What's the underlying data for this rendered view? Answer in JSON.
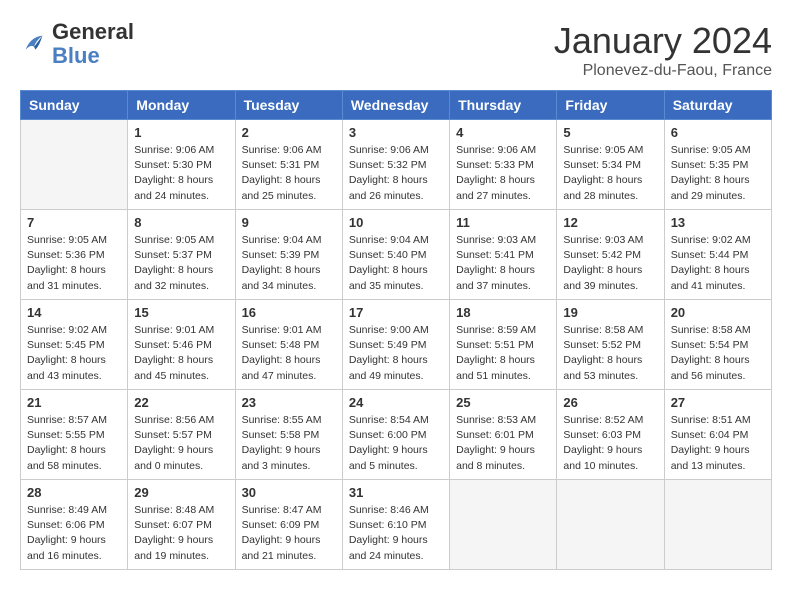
{
  "header": {
    "logo_general": "General",
    "logo_blue": "Blue",
    "month_title": "January 2024",
    "subtitle": "Plonevez-du-Faou, France"
  },
  "days_of_week": [
    "Sunday",
    "Monday",
    "Tuesday",
    "Wednesday",
    "Thursday",
    "Friday",
    "Saturday"
  ],
  "weeks": [
    [
      {
        "num": "",
        "sunrise": "",
        "sunset": "",
        "daylight": ""
      },
      {
        "num": "1",
        "sunrise": "Sunrise: 9:06 AM",
        "sunset": "Sunset: 5:30 PM",
        "daylight": "Daylight: 8 hours and 24 minutes."
      },
      {
        "num": "2",
        "sunrise": "Sunrise: 9:06 AM",
        "sunset": "Sunset: 5:31 PM",
        "daylight": "Daylight: 8 hours and 25 minutes."
      },
      {
        "num": "3",
        "sunrise": "Sunrise: 9:06 AM",
        "sunset": "Sunset: 5:32 PM",
        "daylight": "Daylight: 8 hours and 26 minutes."
      },
      {
        "num": "4",
        "sunrise": "Sunrise: 9:06 AM",
        "sunset": "Sunset: 5:33 PM",
        "daylight": "Daylight: 8 hours and 27 minutes."
      },
      {
        "num": "5",
        "sunrise": "Sunrise: 9:05 AM",
        "sunset": "Sunset: 5:34 PM",
        "daylight": "Daylight: 8 hours and 28 minutes."
      },
      {
        "num": "6",
        "sunrise": "Sunrise: 9:05 AM",
        "sunset": "Sunset: 5:35 PM",
        "daylight": "Daylight: 8 hours and 29 minutes."
      }
    ],
    [
      {
        "num": "7",
        "sunrise": "Sunrise: 9:05 AM",
        "sunset": "Sunset: 5:36 PM",
        "daylight": "Daylight: 8 hours and 31 minutes."
      },
      {
        "num": "8",
        "sunrise": "Sunrise: 9:05 AM",
        "sunset": "Sunset: 5:37 PM",
        "daylight": "Daylight: 8 hours and 32 minutes."
      },
      {
        "num": "9",
        "sunrise": "Sunrise: 9:04 AM",
        "sunset": "Sunset: 5:39 PM",
        "daylight": "Daylight: 8 hours and 34 minutes."
      },
      {
        "num": "10",
        "sunrise": "Sunrise: 9:04 AM",
        "sunset": "Sunset: 5:40 PM",
        "daylight": "Daylight: 8 hours and 35 minutes."
      },
      {
        "num": "11",
        "sunrise": "Sunrise: 9:03 AM",
        "sunset": "Sunset: 5:41 PM",
        "daylight": "Daylight: 8 hours and 37 minutes."
      },
      {
        "num": "12",
        "sunrise": "Sunrise: 9:03 AM",
        "sunset": "Sunset: 5:42 PM",
        "daylight": "Daylight: 8 hours and 39 minutes."
      },
      {
        "num": "13",
        "sunrise": "Sunrise: 9:02 AM",
        "sunset": "Sunset: 5:44 PM",
        "daylight": "Daylight: 8 hours and 41 minutes."
      }
    ],
    [
      {
        "num": "14",
        "sunrise": "Sunrise: 9:02 AM",
        "sunset": "Sunset: 5:45 PM",
        "daylight": "Daylight: 8 hours and 43 minutes."
      },
      {
        "num": "15",
        "sunrise": "Sunrise: 9:01 AM",
        "sunset": "Sunset: 5:46 PM",
        "daylight": "Daylight: 8 hours and 45 minutes."
      },
      {
        "num": "16",
        "sunrise": "Sunrise: 9:01 AM",
        "sunset": "Sunset: 5:48 PM",
        "daylight": "Daylight: 8 hours and 47 minutes."
      },
      {
        "num": "17",
        "sunrise": "Sunrise: 9:00 AM",
        "sunset": "Sunset: 5:49 PM",
        "daylight": "Daylight: 8 hours and 49 minutes."
      },
      {
        "num": "18",
        "sunrise": "Sunrise: 8:59 AM",
        "sunset": "Sunset: 5:51 PM",
        "daylight": "Daylight: 8 hours and 51 minutes."
      },
      {
        "num": "19",
        "sunrise": "Sunrise: 8:58 AM",
        "sunset": "Sunset: 5:52 PM",
        "daylight": "Daylight: 8 hours and 53 minutes."
      },
      {
        "num": "20",
        "sunrise": "Sunrise: 8:58 AM",
        "sunset": "Sunset: 5:54 PM",
        "daylight": "Daylight: 8 hours and 56 minutes."
      }
    ],
    [
      {
        "num": "21",
        "sunrise": "Sunrise: 8:57 AM",
        "sunset": "Sunset: 5:55 PM",
        "daylight": "Daylight: 8 hours and 58 minutes."
      },
      {
        "num": "22",
        "sunrise": "Sunrise: 8:56 AM",
        "sunset": "Sunset: 5:57 PM",
        "daylight": "Daylight: 9 hours and 0 minutes."
      },
      {
        "num": "23",
        "sunrise": "Sunrise: 8:55 AM",
        "sunset": "Sunset: 5:58 PM",
        "daylight": "Daylight: 9 hours and 3 minutes."
      },
      {
        "num": "24",
        "sunrise": "Sunrise: 8:54 AM",
        "sunset": "Sunset: 6:00 PM",
        "daylight": "Daylight: 9 hours and 5 minutes."
      },
      {
        "num": "25",
        "sunrise": "Sunrise: 8:53 AM",
        "sunset": "Sunset: 6:01 PM",
        "daylight": "Daylight: 9 hours and 8 minutes."
      },
      {
        "num": "26",
        "sunrise": "Sunrise: 8:52 AM",
        "sunset": "Sunset: 6:03 PM",
        "daylight": "Daylight: 9 hours and 10 minutes."
      },
      {
        "num": "27",
        "sunrise": "Sunrise: 8:51 AM",
        "sunset": "Sunset: 6:04 PM",
        "daylight": "Daylight: 9 hours and 13 minutes."
      }
    ],
    [
      {
        "num": "28",
        "sunrise": "Sunrise: 8:49 AM",
        "sunset": "Sunset: 6:06 PM",
        "daylight": "Daylight: 9 hours and 16 minutes."
      },
      {
        "num": "29",
        "sunrise": "Sunrise: 8:48 AM",
        "sunset": "Sunset: 6:07 PM",
        "daylight": "Daylight: 9 hours and 19 minutes."
      },
      {
        "num": "30",
        "sunrise": "Sunrise: 8:47 AM",
        "sunset": "Sunset: 6:09 PM",
        "daylight": "Daylight: 9 hours and 21 minutes."
      },
      {
        "num": "31",
        "sunrise": "Sunrise: 8:46 AM",
        "sunset": "Sunset: 6:10 PM",
        "daylight": "Daylight: 9 hours and 24 minutes."
      },
      {
        "num": "",
        "sunrise": "",
        "sunset": "",
        "daylight": ""
      },
      {
        "num": "",
        "sunrise": "",
        "sunset": "",
        "daylight": ""
      },
      {
        "num": "",
        "sunrise": "",
        "sunset": "",
        "daylight": ""
      }
    ]
  ]
}
